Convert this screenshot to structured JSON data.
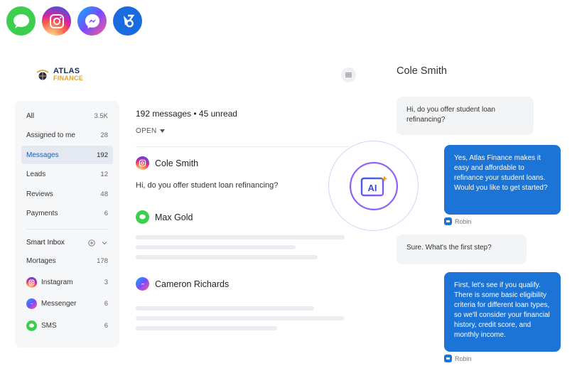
{
  "logo": {
    "line1": "ATLAS",
    "line2": "FINANCE"
  },
  "app_icons": [
    "messages-icon",
    "instagram-icon",
    "messenger-icon",
    "bluebird-icon"
  ],
  "sidebar": {
    "items": [
      {
        "label": "All",
        "count": "3.5K"
      },
      {
        "label": "Assigned to me",
        "count": "28"
      },
      {
        "label": "Messages",
        "count": "192",
        "active": true
      },
      {
        "label": "Leads",
        "count": "12"
      },
      {
        "label": "Reviews",
        "count": "48"
      },
      {
        "label": "Payments",
        "count": "6"
      }
    ],
    "smart_inbox_label": "Smart Inbox",
    "smart_items": [
      {
        "label": "Mortages",
        "count": "178",
        "icon": ""
      },
      {
        "label": "Instagram",
        "count": "3",
        "icon": "instagram-icon"
      },
      {
        "label": "Messenger",
        "count": "6",
        "icon": "messenger-icon"
      },
      {
        "label": "SMS",
        "count": "6",
        "icon": "sms-icon"
      }
    ]
  },
  "inbox": {
    "summary": "192 messages • 45 unread",
    "filter": "OPEN",
    "conversations": [
      {
        "name": "Cole Smith",
        "channel": "instagram-icon",
        "preview": "Hi, do you offer student loan refinancing?"
      },
      {
        "name": "Max Gold",
        "channel": "sms-icon",
        "preview": ""
      },
      {
        "name": "Cameron Richards",
        "channel": "messenger-icon",
        "preview": ""
      }
    ]
  },
  "ai_badge": {
    "label": "AI"
  },
  "chat": {
    "title": "Cole Smith",
    "messages": [
      {
        "dir": "in",
        "text": "Hi, do you offer student loan refinancing?"
      },
      {
        "dir": "out",
        "text": "Yes, Atlas Finance makes it easy and affordable to refinance your student loans. Would you like to get started?",
        "sender": "Robin"
      },
      {
        "dir": "in",
        "text": "Sure. What's the first step?"
      },
      {
        "dir": "out",
        "text": "First, let's see if you qualify. There is some basic eligibility criteria for different loan types, so we'll consider your financial history, credit score, and monthly income.",
        "sender": "Robin"
      }
    ]
  },
  "colors": {
    "accent_blue": "#1b74d6",
    "active_text": "#1a5fb4",
    "ai_purple": "#8b5cf6",
    "brand_gold": "#e0a23a",
    "brand_navy": "#1f2d55"
  }
}
